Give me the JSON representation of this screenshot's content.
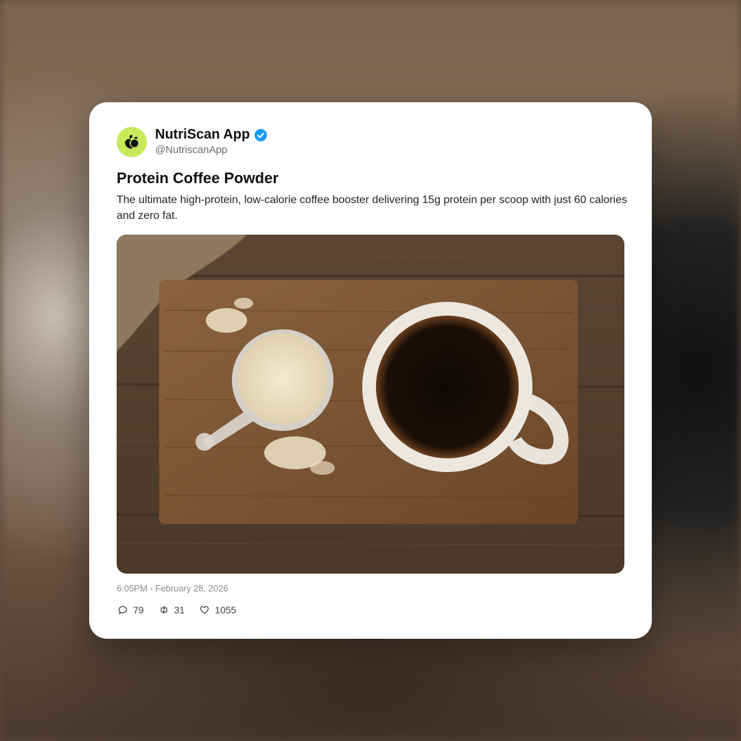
{
  "post": {
    "author_name": "NutriScan App",
    "author_handle": "@NutriscanApp",
    "title": "Protein Coffee Powder",
    "description": "The ultimate high-protein, low-calorie coffee booster delivering 15g protein per scoop with just 60 calories and zero fat.",
    "timestamp": "6:05PM - February 28, 2026",
    "replies": "79",
    "retweets": "31",
    "likes": "1055"
  },
  "icons": {
    "avatar": "nutriscan-logo-icon",
    "verified": "verified-badge-icon",
    "replies": "comment-icon",
    "retweets": "retweet-icon",
    "likes": "heart-icon"
  },
  "colors": {
    "avatar_bg": "#c6ea5a",
    "verified": "#1d9bf0"
  }
}
